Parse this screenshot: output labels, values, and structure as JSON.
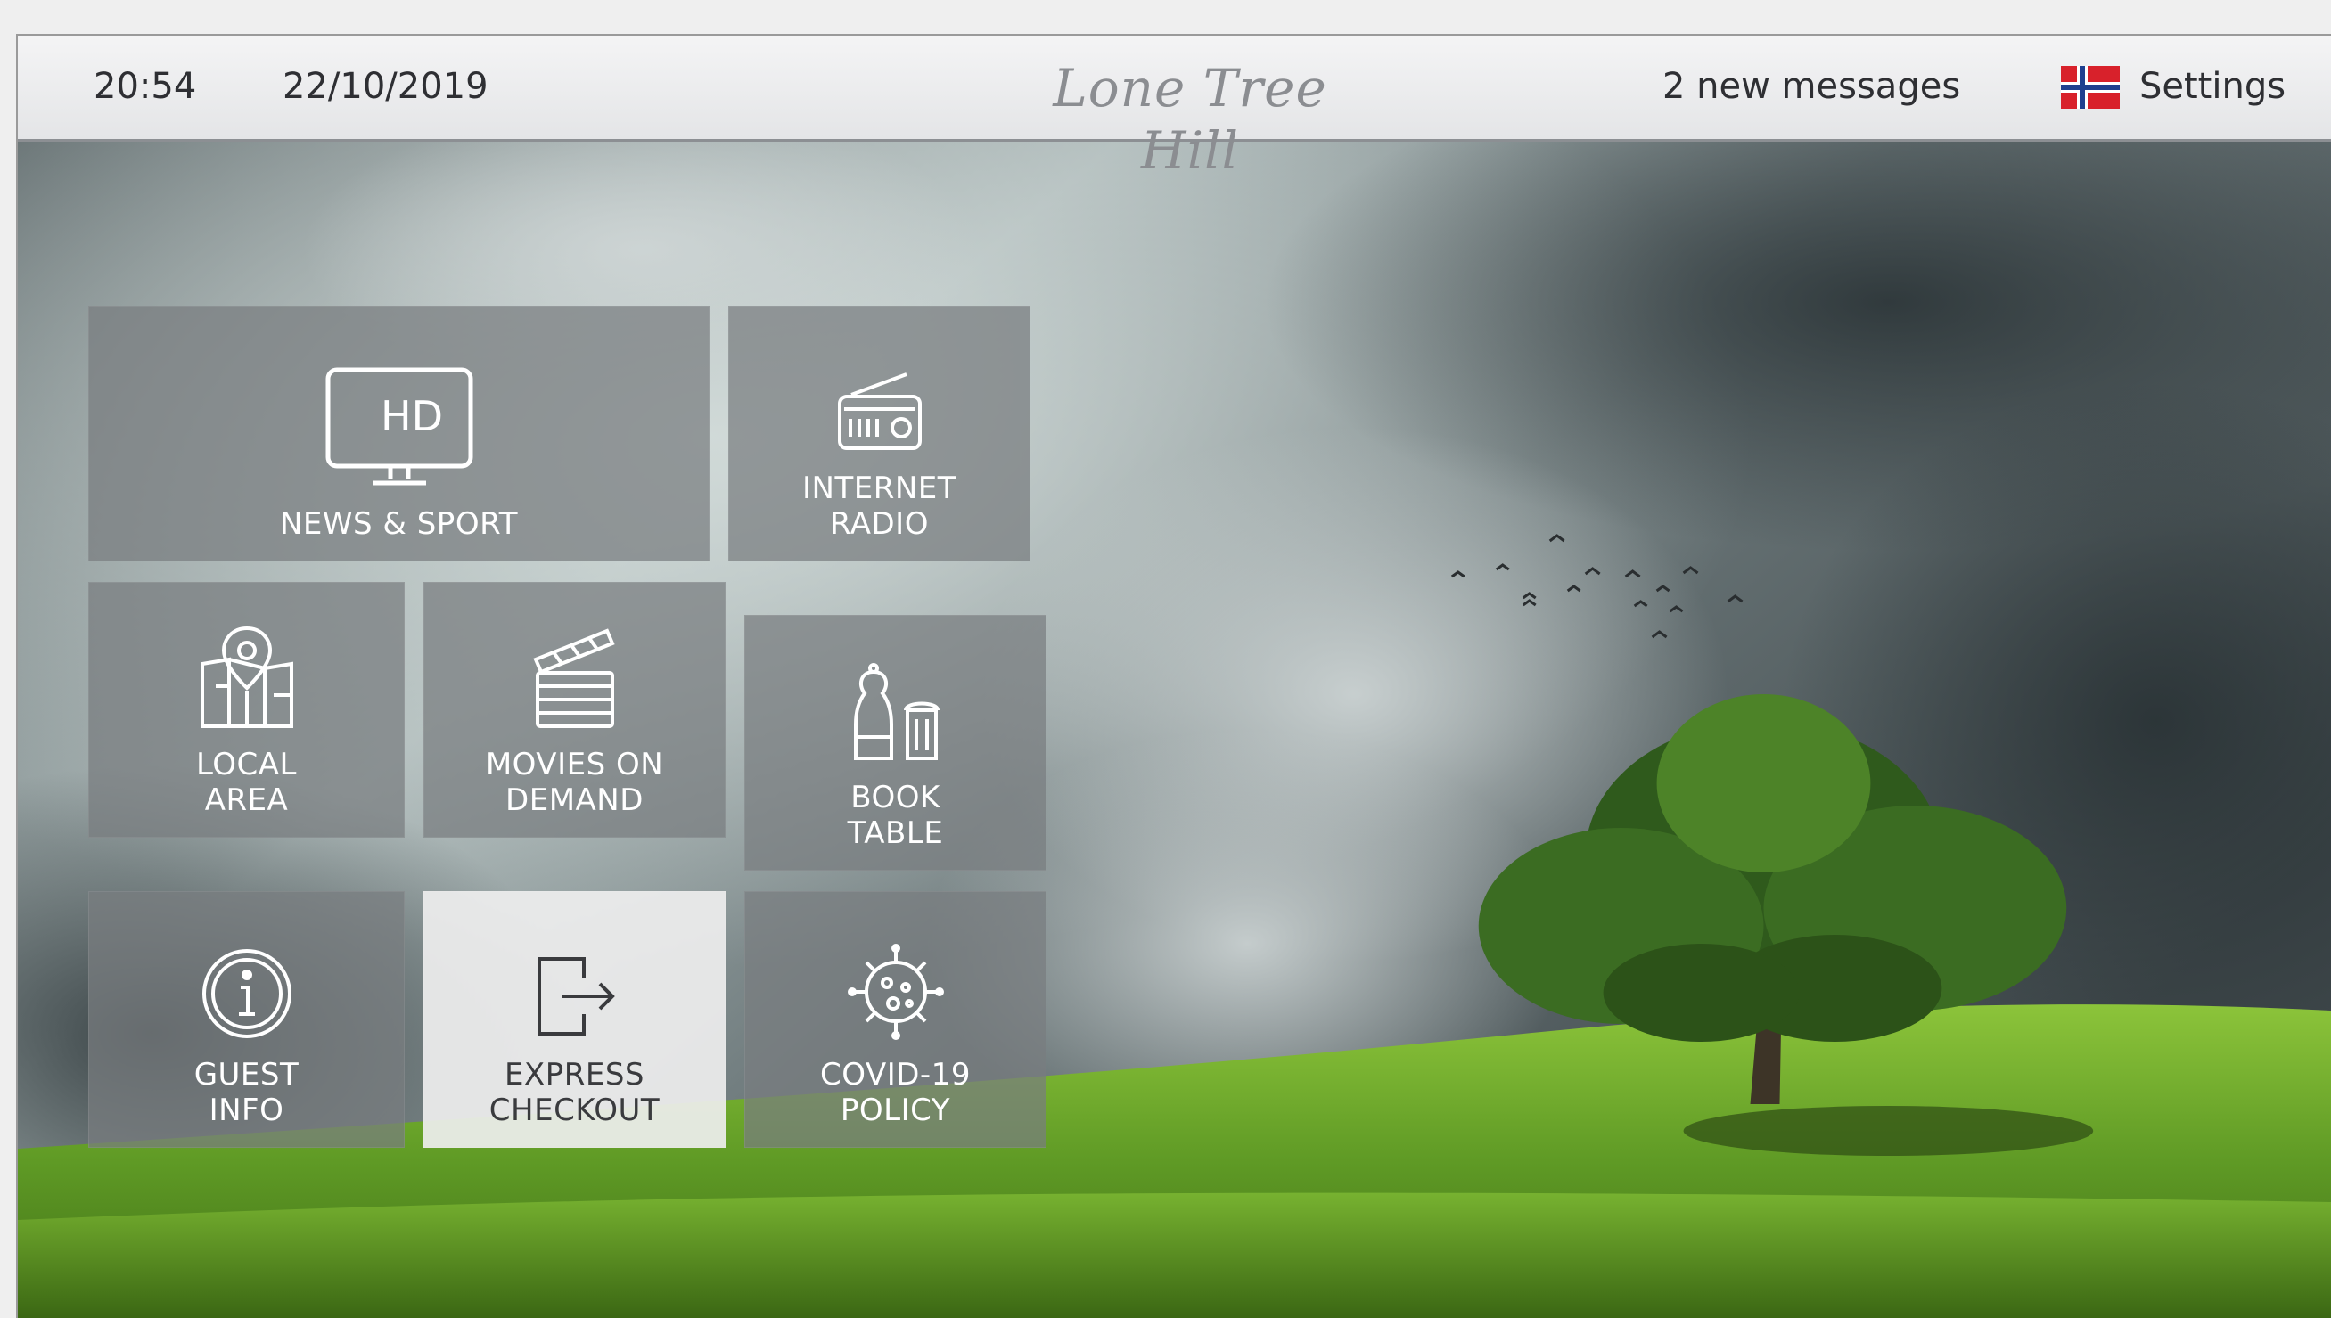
{
  "header": {
    "time": "20:54",
    "date": "22/10/2019",
    "brand": "Lone Tree Hill",
    "messages": "2 new messages",
    "settings_label": "Settings",
    "flag_icon": "norway-flag-icon"
  },
  "tiles": [
    {
      "label": "NEWS & SPORT",
      "icon": "hd-tv-icon"
    },
    {
      "label": "INTERNET\nRADIO",
      "icon": "radio-icon"
    },
    {
      "label": "LOCAL\nAREA",
      "icon": "map-pin-icon"
    },
    {
      "label": "MOVIES ON\nDEMAND",
      "icon": "clapperboard-icon"
    },
    {
      "label": "BOOK\nTABLE",
      "icon": "salt-pepper-icon"
    },
    {
      "label": "GUEST\nINFO",
      "icon": "info-icon"
    },
    {
      "label": "EXPRESS\nCHECKOUT",
      "icon": "exit-door-icon"
    },
    {
      "label": "COVID-19\nPOLICY",
      "icon": "virus-icon"
    }
  ],
  "colors": {
    "tile": "#787d80",
    "tile_highlight": "#eeeeee",
    "grass": "#6aa52a",
    "flag_red": "#d8212b",
    "flag_blue": "#1f3f8f"
  }
}
